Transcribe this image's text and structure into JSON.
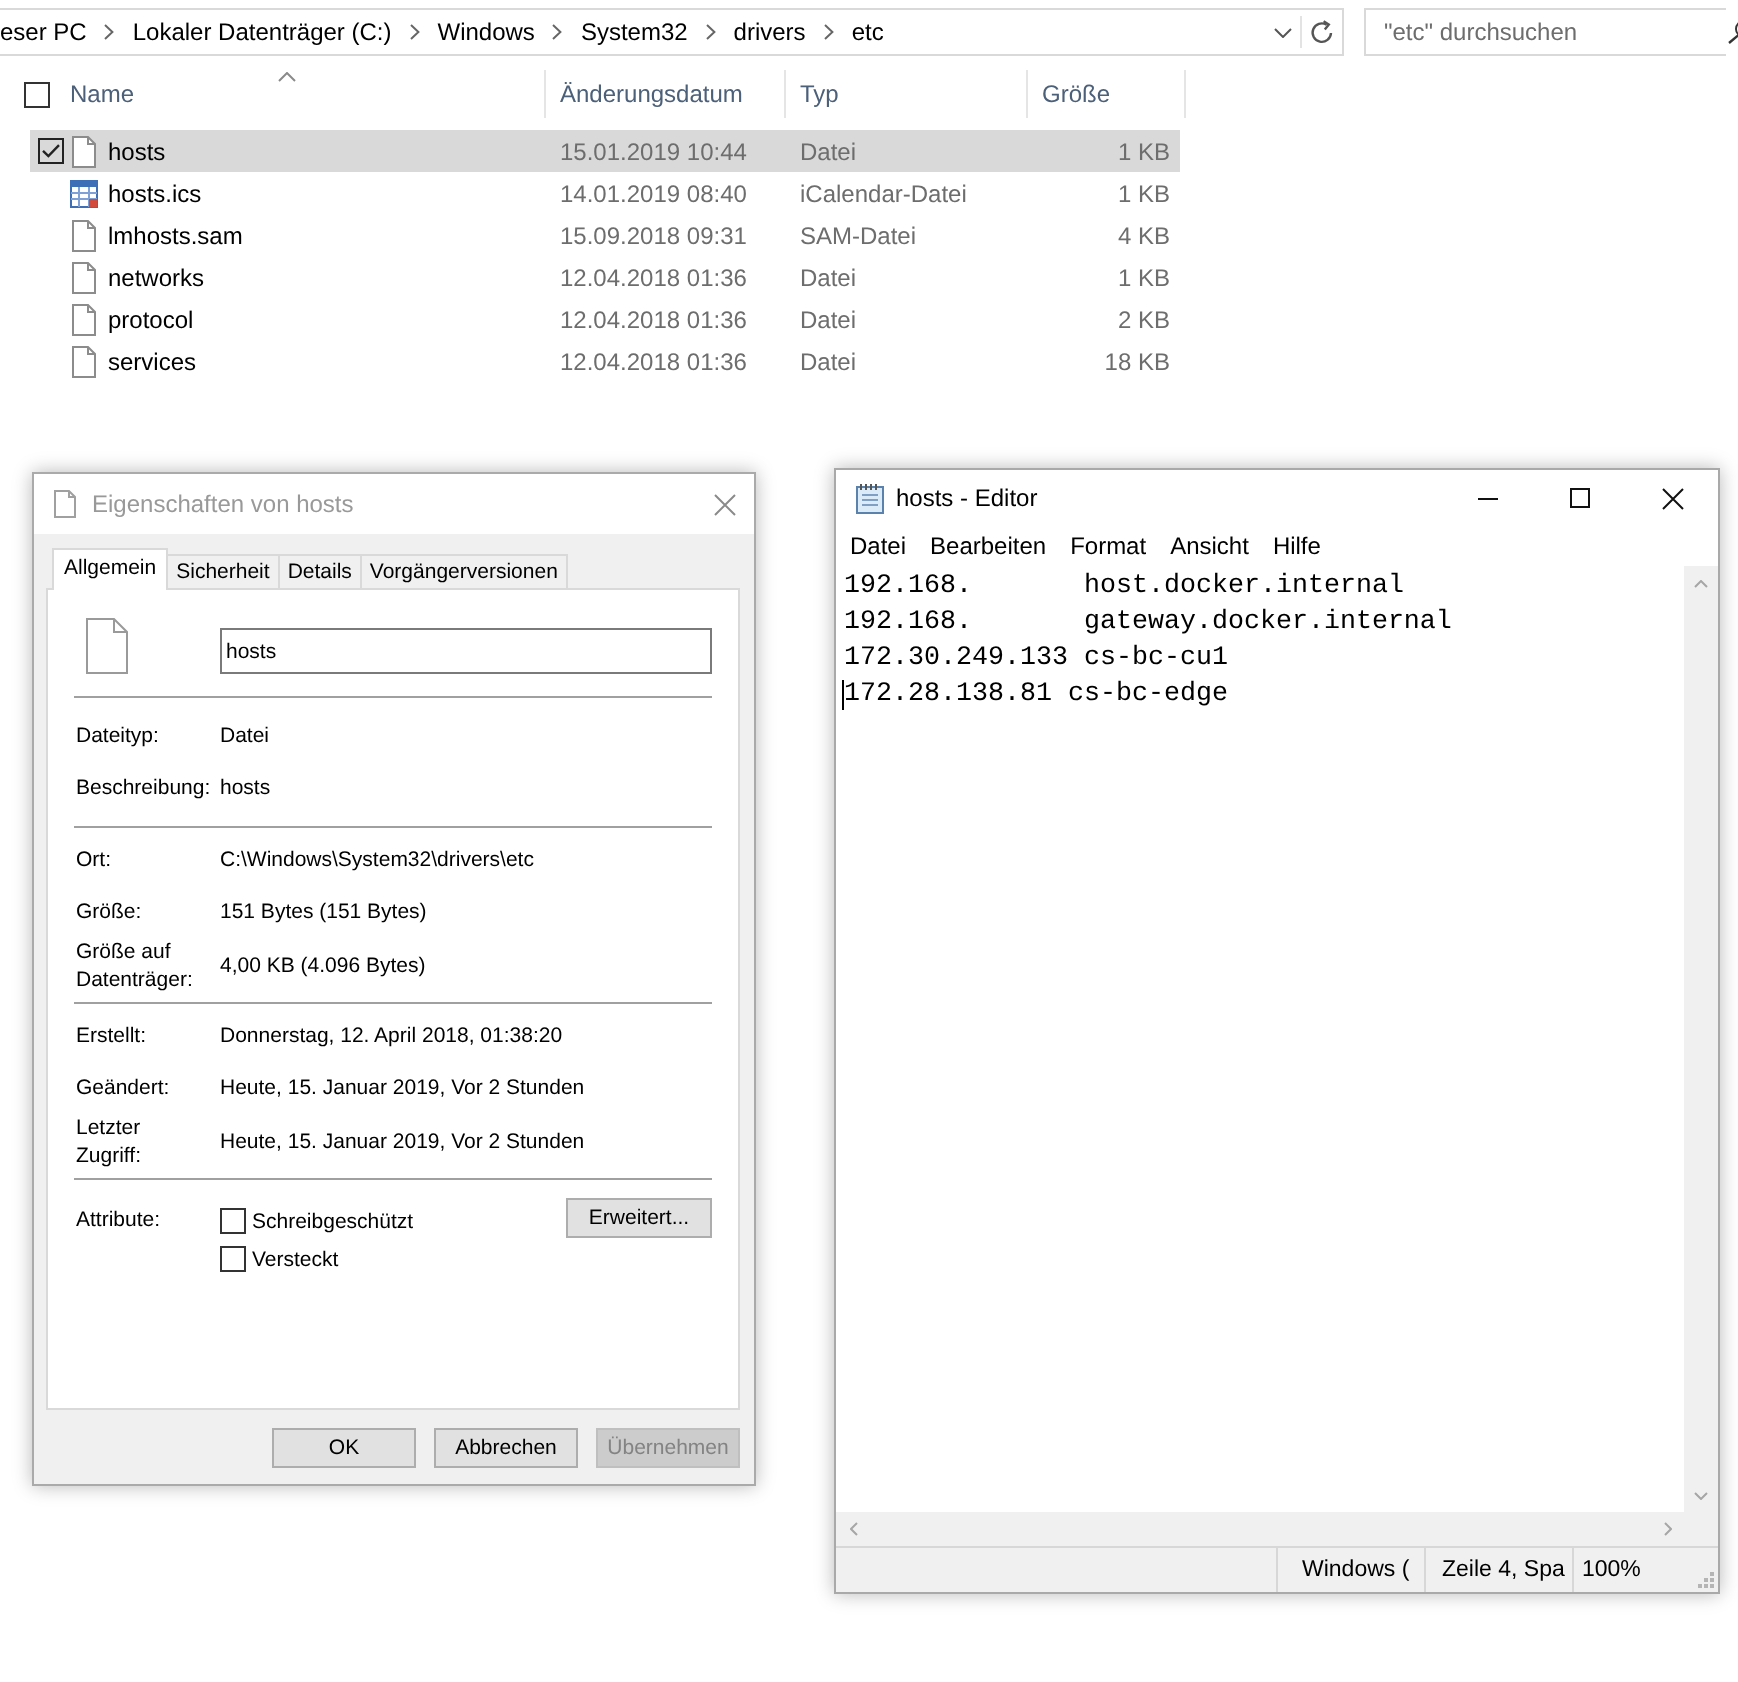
{
  "explorer": {
    "address": [
      "eser PC",
      "Lokaler Datenträger (C:)",
      "Windows",
      "System32",
      "drivers",
      "etc"
    ],
    "search": {
      "placeholder": "\"etc\" durchsuchen"
    },
    "select_all": {
      "checked": false
    },
    "columns": [
      {
        "label": "Name",
        "sorted": true
      },
      {
        "label": "Änderungsdatum",
        "sorted": false
      },
      {
        "label": "Typ",
        "sorted": false
      },
      {
        "label": "Größe",
        "sorted": false
      }
    ],
    "rows": [
      {
        "kind": "file",
        "name": "hosts",
        "modified": "15.01.2019 10:44",
        "type": "Datei",
        "size": "1 KB",
        "selected": true
      },
      {
        "kind": "calendar",
        "name": "hosts.ics",
        "modified": "14.01.2019 08:40",
        "type": "iCalendar-Datei",
        "size": "1 KB",
        "selected": false
      },
      {
        "kind": "file",
        "name": "lmhosts.sam",
        "modified": "15.09.2018 09:31",
        "type": "SAM-Datei",
        "size": "4 KB",
        "selected": false
      },
      {
        "kind": "file",
        "name": "networks",
        "modified": "12.04.2018 01:36",
        "type": "Datei",
        "size": "1 KB",
        "selected": false
      },
      {
        "kind": "file",
        "name": "protocol",
        "modified": "12.04.2018 01:36",
        "type": "Datei",
        "size": "2 KB",
        "selected": false
      },
      {
        "kind": "file",
        "name": "services",
        "modified": "12.04.2018 01:36",
        "type": "Datei",
        "size": "18 KB",
        "selected": false
      }
    ]
  },
  "properties_dialog": {
    "title": "Eigenschaften von hosts",
    "active": false,
    "tabs": [
      {
        "label": "Allgemein",
        "selected": true
      },
      {
        "label": "Sicherheit",
        "selected": false
      },
      {
        "label": "Details",
        "selected": false
      },
      {
        "label": "Vorgängerversionen",
        "selected": false
      }
    ],
    "name_field": {
      "value": "hosts"
    },
    "sections": [
      [
        {
          "label": "Dateityp:",
          "value": "Datei"
        },
        {
          "label": "Beschreibung:",
          "value": "hosts"
        }
      ],
      [
        {
          "label": "Ort:",
          "value": "C:\\Windows\\System32\\drivers\\etc"
        },
        {
          "label": "Größe:",
          "value": "151 Bytes (151 Bytes)"
        },
        {
          "label": "Größe auf\nDatenträger:",
          "value": "4,00 KB (4.096 Bytes)"
        }
      ],
      [
        {
          "label": "Erstellt:",
          "value": "Donnerstag, 12. April 2018, 01:38:20"
        },
        {
          "label": "Geändert:",
          "value": "Heute, 15. Januar 2019, Vor 2 Stunden"
        },
        {
          "label": "Letzter\nZugriff:",
          "value": "Heute, 15. Januar 2019, Vor 2 Stunden"
        }
      ]
    ],
    "attributes": {
      "label": "Attribute:",
      "checkboxes": [
        {
          "label": "Schreibgeschützt",
          "checked": false
        },
        {
          "label": "Versteckt",
          "checked": false
        }
      ],
      "advanced_button": "Erweitert..."
    },
    "buttons": [
      {
        "label": "OK",
        "disabled": false
      },
      {
        "label": "Abbrechen",
        "disabled": false
      },
      {
        "label": "Übernehmen",
        "disabled": true
      }
    ]
  },
  "notepad": {
    "title": "hosts - Editor",
    "active": true,
    "menu": [
      "Datei",
      "Bearbeiten",
      "Format",
      "Ansicht",
      "Hilfe"
    ],
    "lines": [
      {
        "text": "192.168.       host.docker.internal",
        "caret": false
      },
      {
        "text": "192.168.       gateway.docker.internal",
        "caret": false
      },
      {
        "text": "172.30.249.133 cs-bc-cu1",
        "caret": false
      },
      {
        "text": "172.28.138.81 cs-bc-edge",
        "caret": true
      }
    ],
    "status_bar": [
      "Windows (",
      "Zeile 4, Spa",
      "100%"
    ]
  }
}
